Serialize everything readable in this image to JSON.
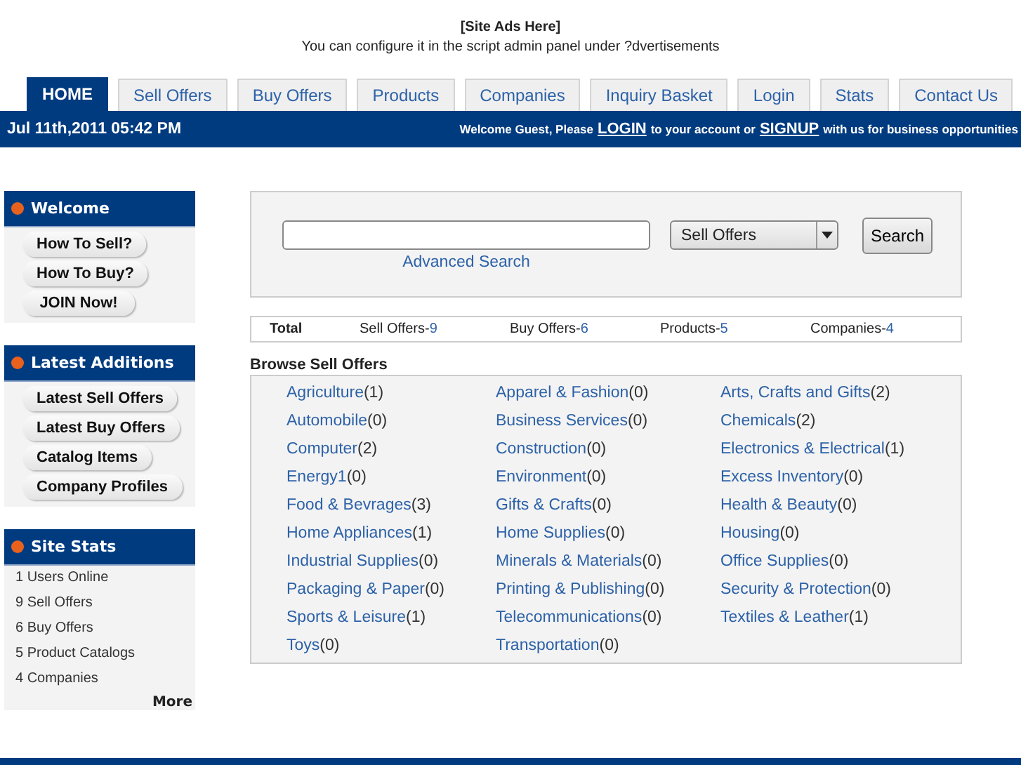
{
  "ads": {
    "title": "[Site Ads Here]",
    "text": "You can configure it in the script admin panel under ?dvertisements"
  },
  "tabs": [
    {
      "label": "HOME",
      "selected": true
    },
    {
      "label": "Sell Offers",
      "selected": false
    },
    {
      "label": "Buy Offers",
      "selected": false
    },
    {
      "label": "Products",
      "selected": false
    },
    {
      "label": "Companies",
      "selected": false
    },
    {
      "label": "Inquiry Basket",
      "selected": false
    },
    {
      "label": "Login",
      "selected": false
    },
    {
      "label": "Stats",
      "selected": false
    },
    {
      "label": "Contact Us",
      "selected": false
    }
  ],
  "info_bar": {
    "date": "Jul 11th,2011 05:42 PM",
    "welcome_before": "Welcome Guest, Please",
    "login": "LOGIN",
    "middle": "to your account or",
    "signup": "SIGNUP",
    "after": "with us for business opportunities"
  },
  "sidebar": [
    {
      "title": "Welcome",
      "kind": "buttons",
      "items": [
        "How To Sell?",
        "How To Buy?",
        "JOIN Now!"
      ]
    },
    {
      "title": "Latest Additions",
      "kind": "buttons",
      "items": [
        "Latest Sell Offers",
        "Latest Buy Offers",
        "Catalog Items",
        "Company Profiles"
      ]
    },
    {
      "title": "Site Stats",
      "kind": "stats",
      "items": [
        "1 Users Online",
        "9 Sell Offers",
        "6 Buy Offers",
        "5 Product Catalogs",
        "4 Companies"
      ],
      "more": "More"
    }
  ],
  "search": {
    "select": "Sell Offers",
    "button": "Search",
    "advanced": "Advanced Search"
  },
  "totals": {
    "label": "Total",
    "items": [
      {
        "label": "Sell Offers-",
        "value": "9"
      },
      {
        "label": "Buy Offers-",
        "value": "6"
      },
      {
        "label": "Products-",
        "value": "5"
      },
      {
        "label": "Companies-",
        "value": "4"
      }
    ]
  },
  "browse": {
    "title": "Browse Sell Offers",
    "categories": [
      {
        "name": "Agriculture",
        "count": "(1)"
      },
      {
        "name": "Apparel & Fashion",
        "count": "(0)"
      },
      {
        "name": "Arts, Crafts and Gifts",
        "count": "(2)"
      },
      {
        "name": "Automobile",
        "count": "(0)"
      },
      {
        "name": "Business Services",
        "count": "(0)"
      },
      {
        "name": "Chemicals",
        "count": "(2)"
      },
      {
        "name": "Computer",
        "count": "(2)"
      },
      {
        "name": "Construction",
        "count": "(0)"
      },
      {
        "name": "Electronics & Electrical",
        "count": "(1)"
      },
      {
        "name": "Energy1",
        "count": "(0)"
      },
      {
        "name": "Environment",
        "count": "(0)"
      },
      {
        "name": "Excess Inventory",
        "count": "(0)"
      },
      {
        "name": "Food & Bevrages",
        "count": "(3)"
      },
      {
        "name": "Gifts & Crafts",
        "count": "(0)"
      },
      {
        "name": "Health & Beauty",
        "count": "(0)"
      },
      {
        "name": "Home Appliances",
        "count": "(1)"
      },
      {
        "name": "Home Supplies",
        "count": "(0)"
      },
      {
        "name": "Housing",
        "count": "(0)"
      },
      {
        "name": "Industrial Supplies",
        "count": "(0)"
      },
      {
        "name": "Minerals & Materials",
        "count": "(0)"
      },
      {
        "name": "Office Supplies",
        "count": "(0)"
      },
      {
        "name": "Packaging & Paper",
        "count": "(0)"
      },
      {
        "name": "Printing & Publishing",
        "count": "(0)"
      },
      {
        "name": "Security & Protection",
        "count": "(0)"
      },
      {
        "name": "Sports & Leisure",
        "count": "(1)"
      },
      {
        "name": "Telecommunications",
        "count": "(0)"
      },
      {
        "name": "Textiles & Leather",
        "count": "(1)"
      },
      {
        "name": "Toys",
        "count": "(0)"
      },
      {
        "name": "Transportation",
        "count": "(0)"
      }
    ]
  }
}
